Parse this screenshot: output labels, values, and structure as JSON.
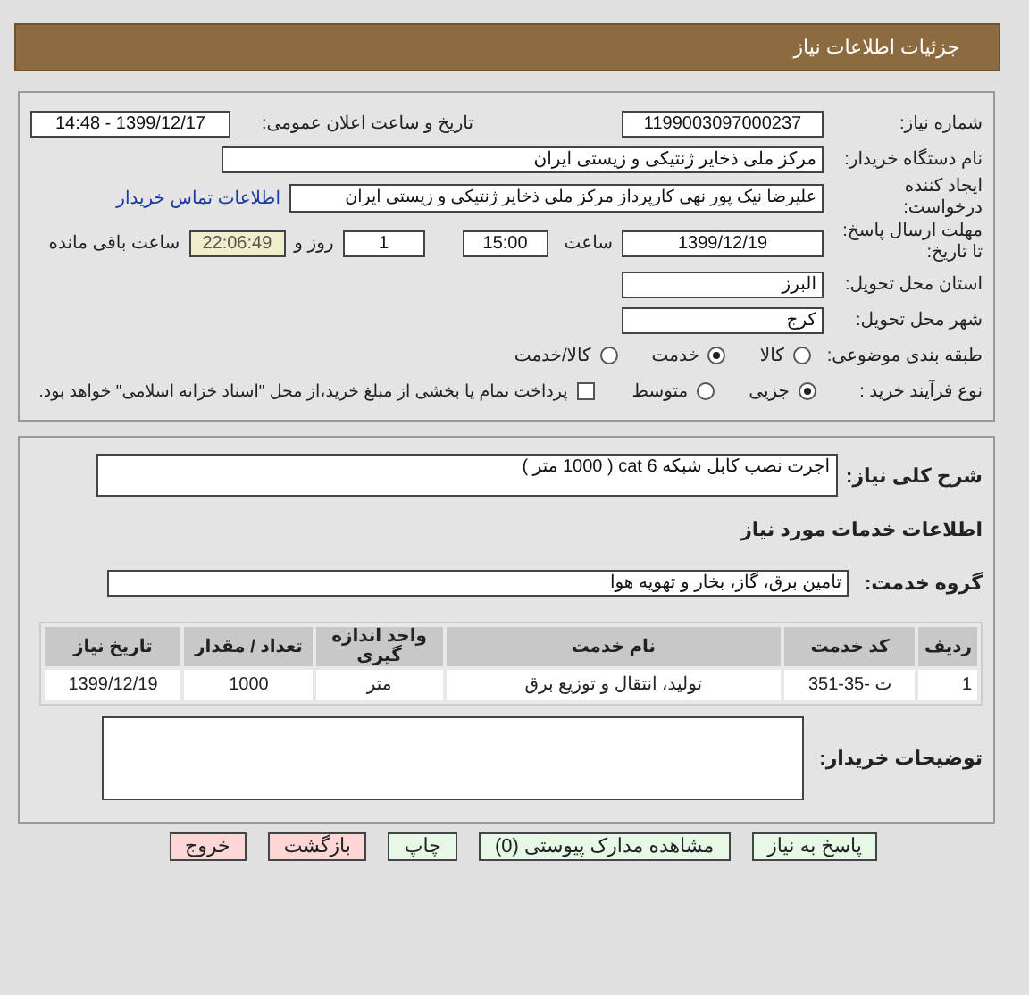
{
  "header": {
    "title": "جزئیات اطلاعات نیاز"
  },
  "need_number": {
    "label": "شماره نیاز:",
    "value": "1199003097000237"
  },
  "announce": {
    "label": "تاریخ و ساعت اعلان عمومی:",
    "value": "1399/12/17 - 14:48"
  },
  "buyer_org": {
    "label": "نام دستگاه خریدار:",
    "value": "مرکز ملی ذخایر ژنتیکی و زیستی ایران"
  },
  "creator": {
    "label": "ایجاد کننده درخواست:",
    "value": "علیرضا نیک پور نهی کارپرداز مرکز ملی ذخایر ژنتیکی و زیستی ایران",
    "link": "اطلاعات تماس خریدار"
  },
  "deadline": {
    "label": "مهلت ارسال پاسخ: تا تاریخ:",
    "date": "1399/12/19",
    "time_label": "ساعت",
    "time": "15:00",
    "days": "1",
    "days_label": "روز و",
    "remaining": "22:06:49",
    "remaining_label": "ساعت باقی مانده"
  },
  "province": {
    "label": "استان محل تحویل:",
    "value": "البرز"
  },
  "city": {
    "label": "شهر محل تحویل:",
    "value": "کرج"
  },
  "category": {
    "label": "طبقه بندی موضوعی:",
    "options": [
      {
        "label": "کالا",
        "selected": false
      },
      {
        "label": "خدمت",
        "selected": true
      },
      {
        "label": "کالا/خدمت",
        "selected": false
      }
    ]
  },
  "process": {
    "label": "نوع فرآیند خرید :",
    "options": [
      {
        "label": "جزیی",
        "selected": true
      },
      {
        "label": "متوسط",
        "selected": false
      }
    ],
    "payment": {
      "label": "پرداخت تمام یا بخشی از مبلغ خرید،از محل \"اسناد خزانه اسلامی\" خواهد بود.",
      "checked": false
    }
  },
  "description": {
    "label": "شرح کلی نیاز:",
    "value": "اجرت نصب کابل شبکه cat 6 ( 1000 متر )"
  },
  "services_title": "اطلاعات خدمات مورد نیاز",
  "service_group": {
    "label": "گروه خدمت:",
    "value": "تامین برق، گاز، بخار و تهویه هوا"
  },
  "table": {
    "columns": [
      "ردیف",
      "کد خدمت",
      "نام خدمت",
      "واحد اندازه گیری",
      "تعداد / مقدار",
      "تاریخ نیاز"
    ],
    "rows": [
      [
        "1",
        "ت -35-351",
        "تولید، انتقال و توزیع برق",
        "متر",
        "1000",
        "1399/12/19"
      ]
    ]
  },
  "buyer_notes": {
    "label": "توضیحات خریدار:"
  },
  "buttons": [
    {
      "label": "پاسخ به نیاز",
      "kind": "action"
    },
    {
      "label": "مشاهده مدارک پیوستی (0)",
      "kind": "action"
    },
    {
      "label": "چاپ",
      "kind": "action"
    },
    {
      "label": "بازگشت",
      "kind": "nav"
    },
    {
      "label": "خروج",
      "kind": "nav"
    }
  ]
}
